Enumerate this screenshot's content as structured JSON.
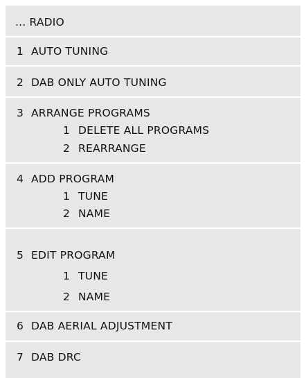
{
  "menu": {
    "title": "... RADIO",
    "items": [
      {
        "number": "1",
        "label": "AUTO TUNING"
      },
      {
        "number": "2",
        "label": "DAB ONLY AUTO TUNING"
      },
      {
        "number": "3",
        "label": "ARRANGE PROGRAMS",
        "subitems": [
          {
            "number": "1",
            "label": "DELETE ALL PROGRAMS"
          },
          {
            "number": "2",
            "label": "REARRANGE"
          }
        ]
      },
      {
        "number": "4",
        "label": "ADD PROGRAM",
        "subitems": [
          {
            "number": "1",
            "label": "TUNE"
          },
          {
            "number": "2",
            "label": "NAME"
          }
        ]
      },
      {
        "number": "5",
        "label": "EDIT PROGRAM",
        "subitems": [
          {
            "number": "1",
            "label": "TUNE"
          },
          {
            "number": "2",
            "label": "NAME"
          }
        ]
      },
      {
        "number": "6",
        "label": "DAB AERIAL ADJUSTMENT"
      },
      {
        "number": "7",
        "label": "DAB DRC"
      }
    ]
  },
  "colors": {
    "panel_background": "#e7e7e7",
    "divider": "#ffffff",
    "text": "#111111"
  }
}
